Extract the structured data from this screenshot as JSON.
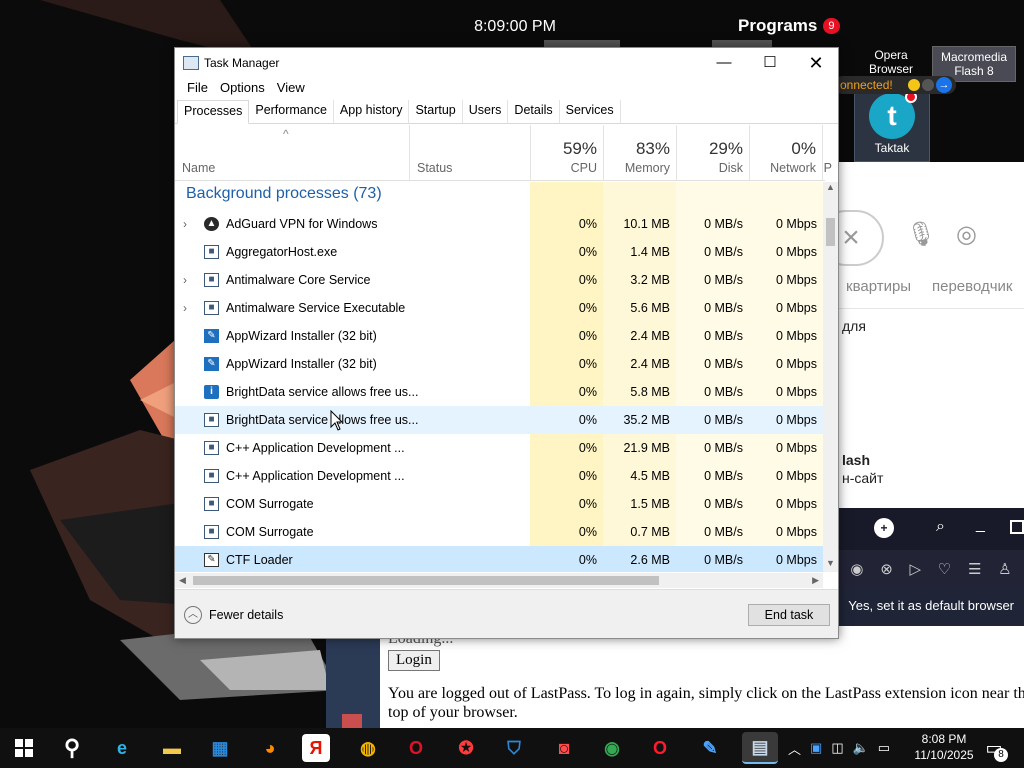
{
  "desktop": {
    "clock": "8:09:00 PM",
    "programs_label": "Programs",
    "programs_badge": "9",
    "icons": [
      {
        "label": "Opera Browser"
      },
      {
        "label": "Macromedia Flash 8"
      },
      {
        "label": "Taktak"
      }
    ],
    "connected_text": "onnected!"
  },
  "right_panel": {
    "labels": [
      "квартиры",
      "переводчик"
    ],
    "text_line1": "для",
    "text_flash": "lash",
    "text_site": "н-сайт",
    "default_banner": "Yes, set it as default browser"
  },
  "lastpass": {
    "loading_text": "Loading...",
    "login_button": "Login",
    "message": "You are logged out of LastPass. To log in again, simply click on the LastPass extension icon near th\ntop of your browser."
  },
  "window": {
    "title": "Task Manager",
    "menu": [
      "File",
      "Options",
      "View"
    ],
    "tabs": [
      "Processes",
      "Performance",
      "App history",
      "Startup",
      "Users",
      "Details",
      "Services"
    ],
    "active_tab": "Processes",
    "columns": {
      "name": "Name",
      "status": "Status",
      "cpu": {
        "pct": "59%",
        "label": "CPU"
      },
      "memory": {
        "pct": "83%",
        "label": "Memory"
      },
      "disk": {
        "pct": "29%",
        "label": "Disk"
      },
      "network": {
        "pct": "0%",
        "label": "Network"
      },
      "power_partial": "P"
    },
    "group_title": "Background processes (73)",
    "processes": [
      {
        "name": "AdGuard VPN for Windows",
        "cpu": "0%",
        "memory": "10.1 MB",
        "disk": "0 MB/s",
        "network": "0 Mbps"
      },
      {
        "name": "AggregatorHost.exe",
        "cpu": "0%",
        "memory": "1.4 MB",
        "disk": "0 MB/s",
        "network": "0 Mbps"
      },
      {
        "name": "Antimalware Core Service",
        "cpu": "0%",
        "memory": "3.2 MB",
        "disk": "0 MB/s",
        "network": "0 Mbps"
      },
      {
        "name": "Antimalware Service Executable",
        "cpu": "0%",
        "memory": "5.6 MB",
        "disk": "0 MB/s",
        "network": "0 Mbps"
      },
      {
        "name": "AppWizard Installer (32 bit)",
        "cpu": "0%",
        "memory": "2.4 MB",
        "disk": "0 MB/s",
        "network": "0 Mbps"
      },
      {
        "name": "AppWizard Installer (32 bit)",
        "cpu": "0%",
        "memory": "2.4 MB",
        "disk": "0 MB/s",
        "network": "0 Mbps"
      },
      {
        "name": "BrightData service allows free us...",
        "cpu": "0%",
        "memory": "5.8 MB",
        "disk": "0 MB/s",
        "network": "0 Mbps"
      },
      {
        "name": "BrightData service allows free us...",
        "cpu": "0%",
        "memory": "35.2 MB",
        "disk": "0 MB/s",
        "network": "0 Mbps"
      },
      {
        "name": "C++ Application Development ...",
        "cpu": "0%",
        "memory": "21.9 MB",
        "disk": "0 MB/s",
        "network": "0 Mbps"
      },
      {
        "name": "C++ Application Development ...",
        "cpu": "0%",
        "memory": "4.5 MB",
        "disk": "0 MB/s",
        "network": "0 Mbps"
      },
      {
        "name": "COM Surrogate",
        "cpu": "0%",
        "memory": "1.5 MB",
        "disk": "0 MB/s",
        "network": "0 Mbps"
      },
      {
        "name": "COM Surrogate",
        "cpu": "0%",
        "memory": "0.7 MB",
        "disk": "0 MB/s",
        "network": "0 Mbps"
      },
      {
        "name": "CTF Loader",
        "cpu": "0%",
        "memory": "2.6 MB",
        "disk": "0 MB/s",
        "network": "0 Mbps"
      }
    ],
    "footer": {
      "fewer_details": "Fewer details",
      "end_task": "End task"
    }
  },
  "taskbar": {
    "time": "8:08 PM",
    "date": "11/10/2025",
    "notification_count": "8",
    "apps": [
      "start-icon",
      "search-icon",
      "edge-icon",
      "file-explorer-icon",
      "store-icon",
      "firefox-icon",
      "yandex-icon",
      "chrome-icon",
      "opera-icon",
      "security-icon",
      "adguard-icon",
      "recorder-icon",
      "chrome-profile-icon",
      "opera-gx-icon",
      "appwizard-icon",
      "task-manager-icon"
    ]
  },
  "colors": {
    "accent": "#1e5fa8",
    "selected_row": "#cce8ff",
    "cpu_tint": "#fff4c4",
    "taskbar": "#101010"
  }
}
